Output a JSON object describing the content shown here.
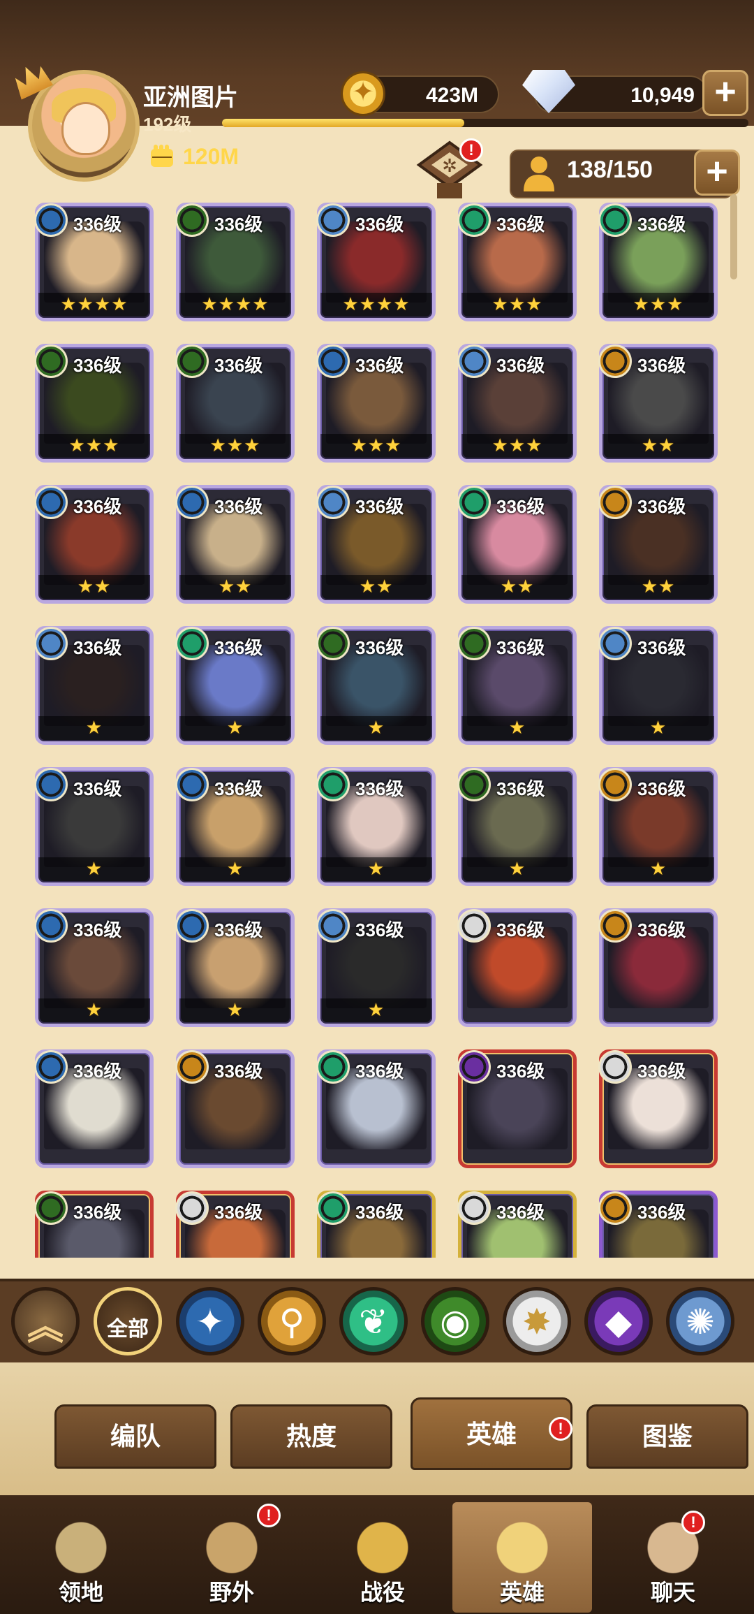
{
  "player": {
    "name": "亚洲图片",
    "level": "192级",
    "xp_fraction": 0.46,
    "power": "120M"
  },
  "resources": {
    "gold": "423M",
    "gems": "10,949",
    "hero_count": "138/150"
  },
  "badges": {
    "sort": "!",
    "heroes_tab": "!",
    "wild": "!",
    "chat": "!"
  },
  "faction_colors": {
    "lightbearer": "#2d6ab0",
    "mauler": "#c8861a",
    "wilder": "#1f9e6a",
    "graveborn": "#2f6b22",
    "celestial": "#d9d9d9",
    "hypogean": "#6a2fa0",
    "dimensional": "#4f86c6"
  },
  "heroes": [
    {
      "level": "336级",
      "stars": "★★★★",
      "faction": "lightbearer",
      "tone": "#d8b68a",
      "frame": "purple"
    },
    {
      "level": "336级",
      "stars": "★★★★",
      "faction": "graveborn",
      "tone": "#3e5a3a",
      "frame": "purple"
    },
    {
      "level": "336级",
      "stars": "★★★★",
      "faction": "dimensional",
      "tone": "#8a2a2a",
      "frame": "purple"
    },
    {
      "level": "336级",
      "stars": "★★★",
      "faction": "wilder",
      "tone": "#b86a4a",
      "frame": "purple"
    },
    {
      "level": "336级",
      "stars": "★★★",
      "faction": "wilder",
      "tone": "#7aa05a",
      "frame": "purple"
    },
    {
      "level": "336级",
      "stars": "★★★",
      "faction": "graveborn",
      "tone": "#3b4a1f",
      "frame": "purple"
    },
    {
      "level": "336级",
      "stars": "★★★",
      "faction": "graveborn",
      "tone": "#3a4450",
      "frame": "purple"
    },
    {
      "level": "336级",
      "stars": "★★★",
      "faction": "lightbearer",
      "tone": "#7a5a3c",
      "frame": "purple"
    },
    {
      "level": "336级",
      "stars": "★★★",
      "faction": "dimensional",
      "tone": "#5a4038",
      "frame": "purple"
    },
    {
      "level": "336级",
      "stars": "★★",
      "faction": "mauler",
      "tone": "#4a4a4a",
      "frame": "purple"
    },
    {
      "level": "336级",
      "stars": "★★",
      "faction": "lightbearer",
      "tone": "#8a3a2a",
      "frame": "purple"
    },
    {
      "level": "336级",
      "stars": "★★",
      "faction": "lightbearer",
      "tone": "#c8b08a",
      "frame": "purple"
    },
    {
      "level": "336级",
      "stars": "★★",
      "faction": "dimensional",
      "tone": "#7a5a2a",
      "frame": "purple"
    },
    {
      "level": "336级",
      "stars": "★★",
      "faction": "wilder",
      "tone": "#d88aa0",
      "frame": "purple"
    },
    {
      "level": "336级",
      "stars": "★★",
      "faction": "mauler",
      "tone": "#4a3024",
      "frame": "purple"
    },
    {
      "level": "336级",
      "stars": "★",
      "faction": "dimensional",
      "tone": "#2a2020",
      "frame": "purple"
    },
    {
      "level": "336级",
      "stars": "★",
      "faction": "wilder",
      "tone": "#6a7ac8",
      "frame": "purple"
    },
    {
      "level": "336级",
      "stars": "★",
      "faction": "graveborn",
      "tone": "#3a5468",
      "frame": "purple"
    },
    {
      "level": "336级",
      "stars": "★",
      "faction": "graveborn",
      "tone": "#5a4a6a",
      "frame": "purple"
    },
    {
      "level": "336级",
      "stars": "★",
      "faction": "dimensional",
      "tone": "#2a2a32",
      "frame": "purple"
    },
    {
      "level": "336级",
      "stars": "★",
      "faction": "lightbearer",
      "tone": "#3a3a3a",
      "frame": "purple"
    },
    {
      "level": "336级",
      "stars": "★",
      "faction": "lightbearer",
      "tone": "#c8a06a",
      "frame": "purple"
    },
    {
      "level": "336级",
      "stars": "★",
      "faction": "wilder",
      "tone": "#e0c8c0",
      "frame": "purple"
    },
    {
      "level": "336级",
      "stars": "★",
      "faction": "graveborn",
      "tone": "#6a6a50",
      "frame": "purple"
    },
    {
      "level": "336级",
      "stars": "★",
      "faction": "mauler",
      "tone": "#7a3a2a",
      "frame": "purple"
    },
    {
      "level": "336级",
      "stars": "★",
      "faction": "lightbearer",
      "tone": "#6a4a3a",
      "frame": "purple"
    },
    {
      "level": "336级",
      "stars": "★",
      "faction": "lightbearer",
      "tone": "#c8a070",
      "frame": "purple"
    },
    {
      "level": "336级",
      "stars": "★",
      "faction": "dimensional",
      "tone": "#2a2a2a",
      "frame": "purple"
    },
    {
      "level": "336级",
      "stars": "",
      "faction": "celestial",
      "tone": "#c04a2a",
      "frame": "purple"
    },
    {
      "level": "336级",
      "stars": "",
      "faction": "mauler",
      "tone": "#8a2a3a",
      "frame": "purple"
    },
    {
      "level": "336级",
      "stars": "",
      "faction": "lightbearer",
      "tone": "#e0dcd0",
      "frame": "purple"
    },
    {
      "level": "336级",
      "stars": "",
      "faction": "mauler",
      "tone": "#6a4a30",
      "frame": "purple"
    },
    {
      "level": "336级",
      "stars": "",
      "faction": "wilder",
      "tone": "#b8c0d0",
      "frame": "purple"
    },
    {
      "level": "336级",
      "stars": "",
      "faction": "hypogean",
      "tone": "#4a4458",
      "frame": "red"
    },
    {
      "level": "336级",
      "stars": "",
      "faction": "celestial",
      "tone": "#ece0d8",
      "frame": "red"
    },
    {
      "level": "336级",
      "stars": "",
      "faction": "graveborn",
      "tone": "#5a5a6a",
      "frame": "red"
    },
    {
      "level": "336级",
      "stars": "",
      "faction": "celestial",
      "tone": "#c86a3a",
      "frame": "red"
    },
    {
      "level": "336级",
      "stars": "",
      "faction": "wilder",
      "tone": "#8a6a3a",
      "frame": "gold"
    },
    {
      "level": "336级",
      "stars": "",
      "faction": "celestial",
      "tone": "#a0c070",
      "frame": "gold"
    },
    {
      "level": "336级",
      "stars": "",
      "faction": "mauler",
      "tone": "#7a6a3a",
      "frame": "violet"
    }
  ],
  "filters": {
    "up_label": "",
    "all_label": "全部",
    "factions": [
      {
        "name": "lightbearer-icon",
        "glyph": "✦",
        "color": "#2d6ab0",
        "ring": "#1b3e6e"
      },
      {
        "name": "mauler-icon",
        "glyph": "⚲",
        "color": "#e0a23a",
        "ring": "#8a5a14"
      },
      {
        "name": "wilder-icon",
        "glyph": "❦",
        "color": "#2fbf86",
        "ring": "#17664a"
      },
      {
        "name": "graveborn-icon",
        "glyph": "◉",
        "color": "#3f8a2a",
        "ring": "#1e4a14"
      },
      {
        "name": "celestial-icon",
        "glyph": "✸",
        "color": "#ededed",
        "ring": "#9a9a9a"
      },
      {
        "name": "hypogean-icon",
        "glyph": "◆",
        "color": "#7a3ab8",
        "ring": "#3a1a60"
      },
      {
        "name": "dimensional-icon",
        "glyph": "✺",
        "color": "#6e9ad0",
        "ring": "#2a4a78"
      }
    ]
  },
  "tabs": [
    "编队",
    "热度",
    "英雄",
    "图鉴"
  ],
  "active_tab": "英雄",
  "nav": [
    {
      "label": "领地",
      "icon": "castle-icon",
      "color": "#c9b07a"
    },
    {
      "label": "野外",
      "icon": "map-scroll-icon",
      "color": "#c9a46a"
    },
    {
      "label": "战役",
      "icon": "campaign-shield-icon",
      "color": "#e0b44a"
    },
    {
      "label": "英雄",
      "icon": "hero-helmet-icon",
      "color": "#f0d27a"
    },
    {
      "label": "聊天",
      "icon": "chat-bubble-icon",
      "color": "#d8b890"
    }
  ]
}
